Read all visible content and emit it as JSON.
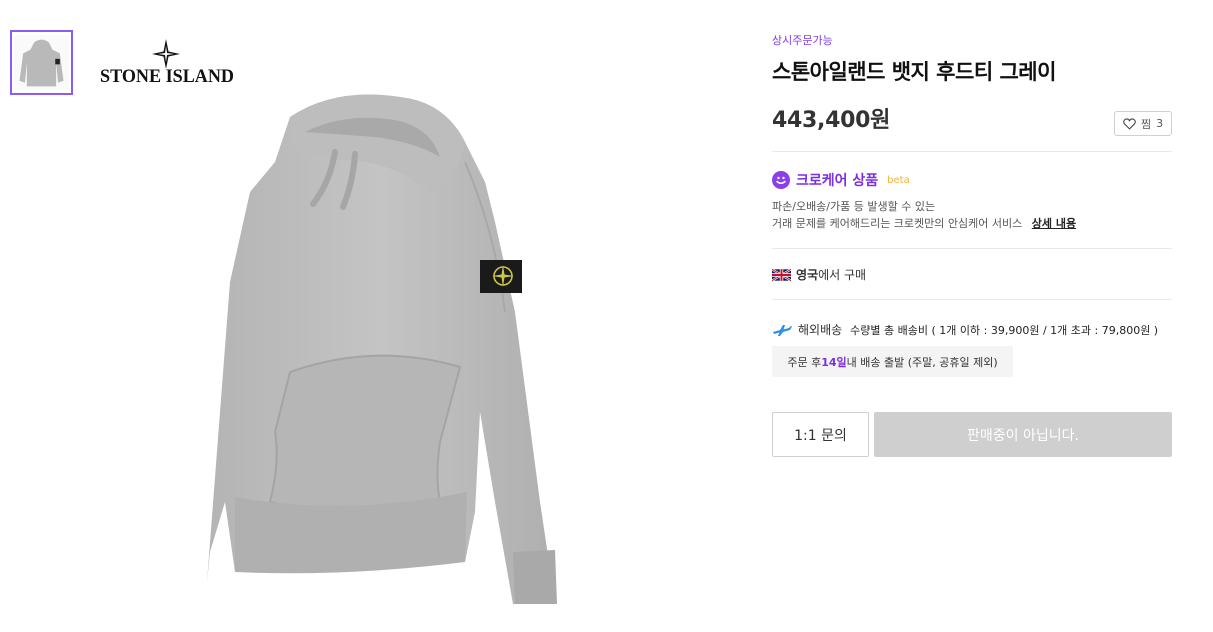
{
  "gallery": {
    "brand": "STONE ISLAND"
  },
  "product": {
    "availability_badge": "상시주문가능",
    "title": "스톤아일랜드 뱃지 후드티 그레이",
    "price": "443,400원",
    "wishlist": {
      "label": "찜",
      "count": "3"
    }
  },
  "care": {
    "title": "크로케어 상품",
    "beta_label": "beta",
    "desc_line1": "파손/오배송/가품 등 발생할 수 있는",
    "desc_line2": "거래 문제를 케어해드리는 크로켓만의 안심케어 서비스",
    "detail_link": "상세 내용"
  },
  "origin": {
    "country": "영국",
    "suffix": "에서 구매"
  },
  "shipping": {
    "type": "해외배송",
    "fee_info": "수량별 총 배송비 ( 1개 이하 : 39,900원 / 1개 초과 : 79,800원 )",
    "note_prefix": "주문 후 ",
    "note_days": "14일",
    "note_suffix": " 내 배송 출발 (주말, 공휴일 제외)"
  },
  "actions": {
    "inquiry_label": "1:1 문의",
    "sold_out_label": "판매중이 아닙니다."
  },
  "colors": {
    "accent": "#7b2fe0",
    "beta": "#f2b53a",
    "disabled_button": "#cfcfcf"
  }
}
